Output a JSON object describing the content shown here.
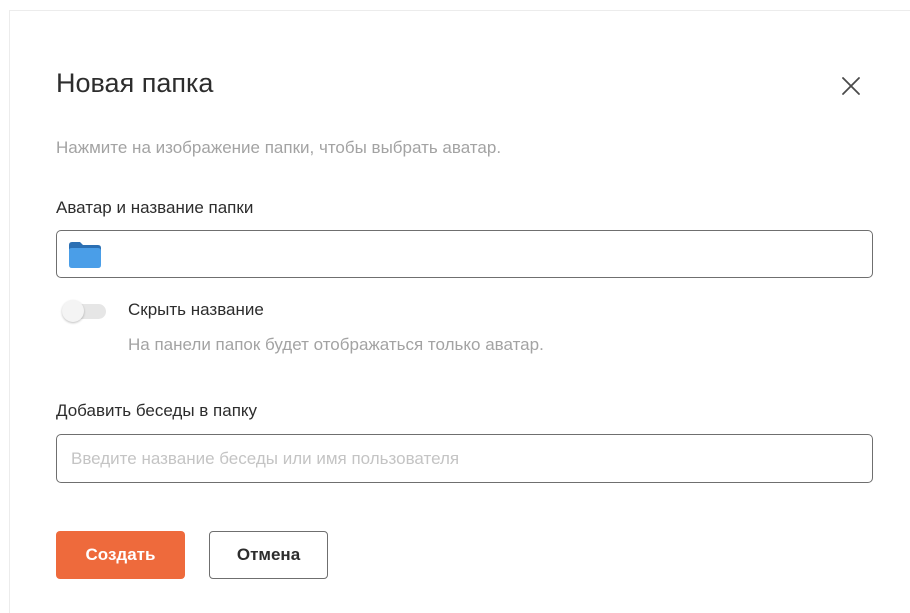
{
  "dialog": {
    "title": "Новая папка",
    "hint": "Нажмите на изображение папки, чтобы выбрать аватар.",
    "close_icon": "close-icon"
  },
  "avatar_section": {
    "label": "Аватар и название папки",
    "folder_icon": "folder-icon",
    "folder_color": "#4a9ee8",
    "folder_tab_color": "#2b6fb3",
    "name_value": ""
  },
  "hide_name": {
    "label": "Скрыть название",
    "description": "На панели папок будет отображаться только аватар.",
    "enabled": false
  },
  "chats_section": {
    "label": "Добавить беседы в папку",
    "placeholder": "Введите название беседы или имя пользователя",
    "value": ""
  },
  "buttons": {
    "create_label": "Создать",
    "cancel_label": "Отмена"
  },
  "colors": {
    "accent": "#ee6a3c",
    "text": "#2d2d2d",
    "muted": "#a3a3a3",
    "border": "#6f6f6f"
  }
}
